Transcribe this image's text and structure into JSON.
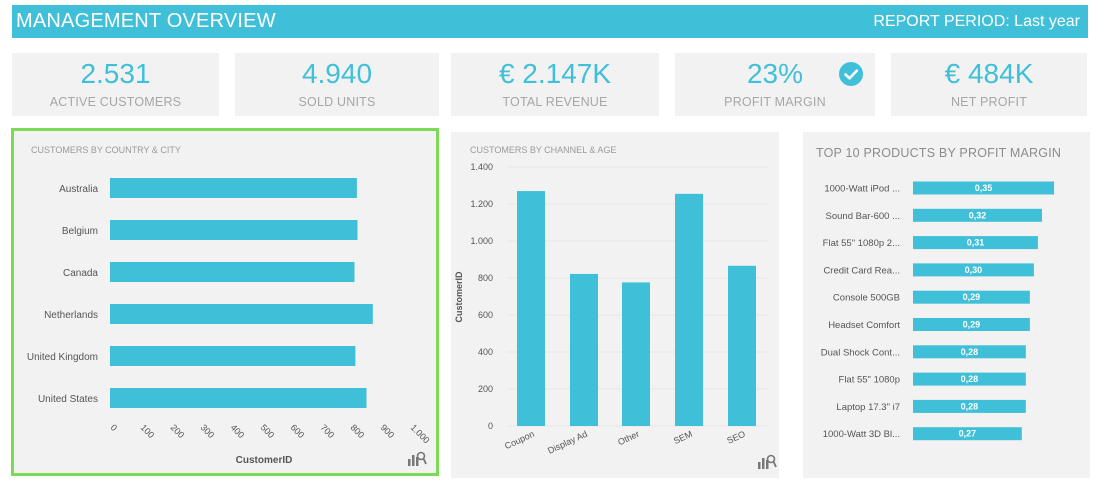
{
  "header": {
    "title": "MANAGEMENT OVERVIEW",
    "period": "REPORT PERIOD:  Last year"
  },
  "kpis": [
    {
      "value": "2.531",
      "label": "ACTIVE CUSTOMERS"
    },
    {
      "value": "4.940",
      "label": "SOLD UNITS"
    },
    {
      "value": "€ 2.147K",
      "label": "TOTAL REVENUE"
    },
    {
      "value": "23%",
      "label": "PROFIT MARGIN",
      "icon": "check-circle-icon"
    },
    {
      "value": "€ 484K",
      "label": "NET PROFIT"
    }
  ],
  "colors": {
    "accent": "#3fc0d8",
    "highlight_border": "#7ed957",
    "panel_bg": "#f2f2f2"
  },
  "chart_data": [
    {
      "type": "bar",
      "orientation": "horizontal",
      "title": "CUSTOMERS BY COUNTRY & CITY",
      "categories": [
        "Australia",
        "Belgium",
        "Canada",
        "Netherlands",
        "United Kingdom",
        "United States"
      ],
      "values": [
        823,
        825,
        815,
        876,
        818,
        855
      ],
      "xlabel": "CustomerID",
      "xticks": [
        "0",
        "100",
        "200",
        "300",
        "400",
        "500",
        "600",
        "700",
        "800",
        "900",
        "1.000"
      ],
      "xlim": [
        0,
        1000
      ]
    },
    {
      "type": "bar",
      "title": "CUSTOMERS BY CHANNEL & AGE",
      "categories": [
        "Coupon",
        "Display Ad",
        "Other",
        "SEM",
        "SEO"
      ],
      "values": [
        1270,
        822,
        776,
        1255,
        866
      ],
      "ylabel": "CustomerID",
      "yticks": [
        "0",
        "200",
        "400",
        "600",
        "800",
        "1.000",
        "1.200",
        "1.400"
      ],
      "ylim": [
        0,
        1400
      ]
    },
    {
      "type": "bar",
      "orientation": "horizontal",
      "title": "TOP 10 PRODUCTS BY PROFIT MARGIN",
      "categories": [
        "1000-Watt iPod ...",
        "Sound Bar-600 ...",
        "Flat 55\" 1080p 2...",
        "Credit Card Rea...",
        "Console 500GB",
        "Headset Comfort",
        "Dual Shock Cont...",
        "Flat 55\" 1080p",
        "Laptop 17.3\" i7",
        "1000-Watt 3D Bl..."
      ],
      "values": [
        0.35,
        0.32,
        0.31,
        0.3,
        0.29,
        0.29,
        0.28,
        0.28,
        0.28,
        0.27
      ],
      "labels": [
        "0,35",
        "0,32",
        "0,31",
        "0,30",
        "0,29",
        "0,29",
        "0,28",
        "0,28",
        "0,28",
        "0,27"
      ]
    }
  ]
}
